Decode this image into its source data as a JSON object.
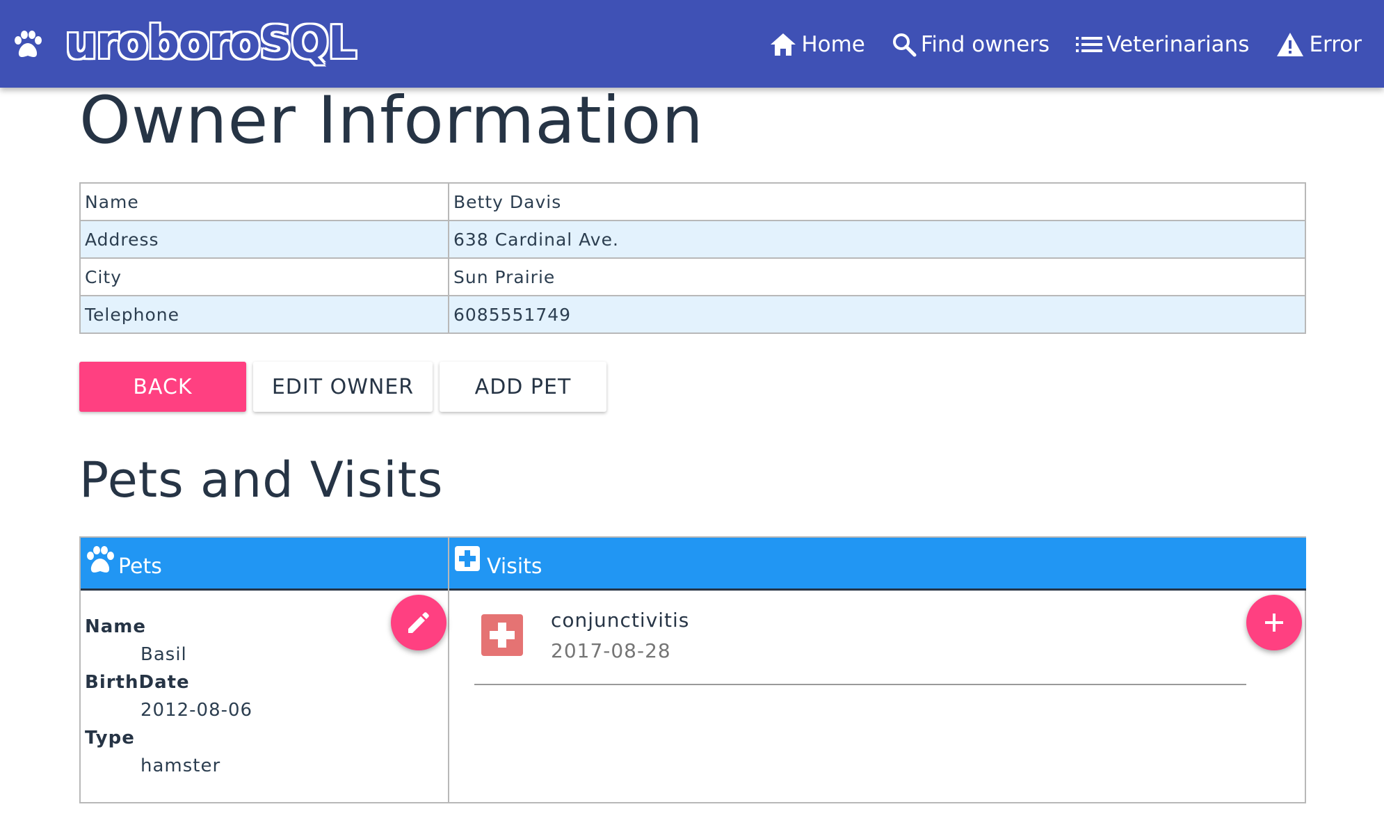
{
  "brand": {
    "logo_text": "uroboro",
    "logo_text_sql": "SQL"
  },
  "nav": [
    {
      "label": "Home",
      "icon": "home-icon"
    },
    {
      "label": "Find owners",
      "icon": "search-icon"
    },
    {
      "label": "Veterinarians",
      "icon": "list-icon"
    },
    {
      "label": "Error",
      "icon": "warning-icon"
    }
  ],
  "page_title": "Owner Information",
  "owner": {
    "rows": [
      {
        "label": "Name",
        "value": "Betty Davis"
      },
      {
        "label": "Address",
        "value": "638 Cardinal Ave."
      },
      {
        "label": "City",
        "value": "Sun Prairie"
      },
      {
        "label": "Telephone",
        "value": "6085551749"
      }
    ]
  },
  "buttons": {
    "back": "BACK",
    "edit_owner": "EDIT OWNER",
    "add_pet": "ADD PET"
  },
  "section_title": "Pets and Visits",
  "pets_header": "Pets",
  "visits_header": "Visits",
  "pet": {
    "name_label": "Name",
    "name": "Basil",
    "birthdate_label": "BirthDate",
    "birthdate": "2012-08-06",
    "type_label": "Type",
    "type": "hamster"
  },
  "visits": [
    {
      "description": "conjunctivitis",
      "date": "2017-08-28"
    }
  ],
  "colors": {
    "primary": "#3f51b5",
    "accent": "#ff4081",
    "header_blue": "#2196f3",
    "row_alt": "#e3f2fd",
    "visit_icon": "#e57373"
  }
}
